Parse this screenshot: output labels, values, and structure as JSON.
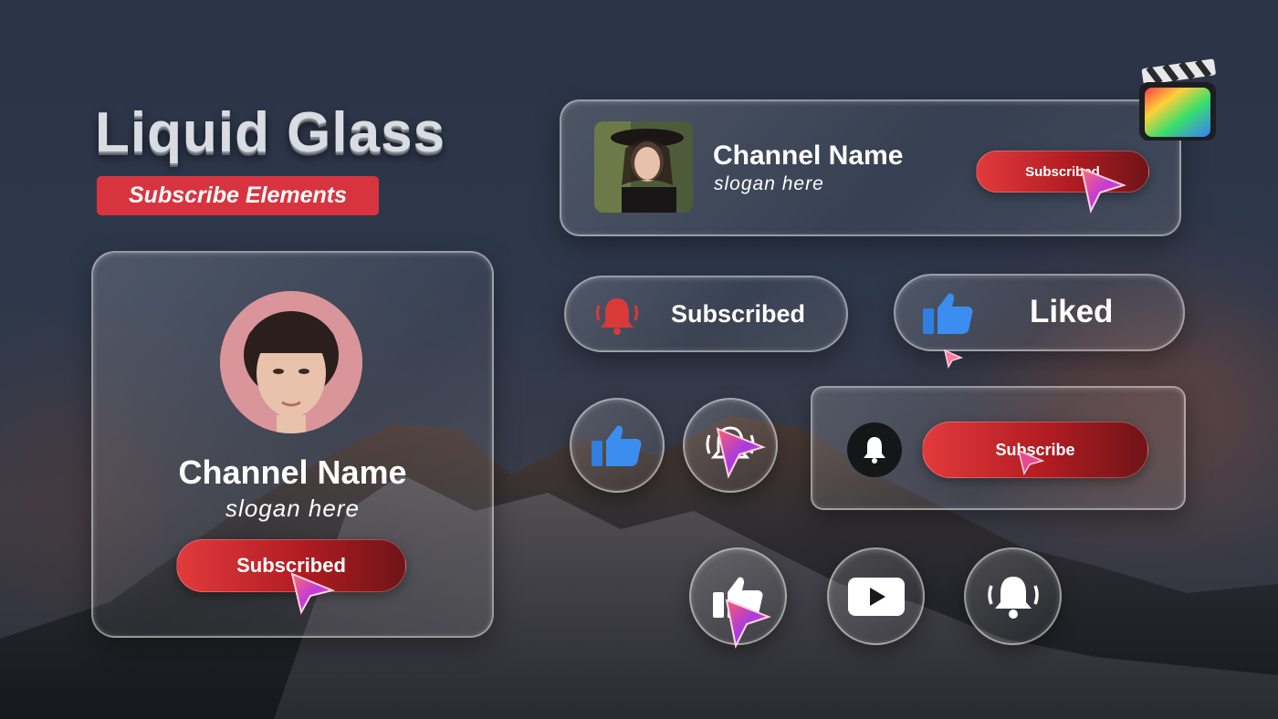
{
  "title": "Liquid Glass",
  "subtitle": "Subscribe Elements",
  "big_card": {
    "channel_name": "Channel Name",
    "slogan": "slogan here",
    "button_label": "Subscribed"
  },
  "top_card": {
    "channel_name": "Channel Name",
    "slogan": "slogan here",
    "button_label": "Subscribed"
  },
  "pill_subscribed": {
    "label": "Subscribed"
  },
  "pill_liked": {
    "label": "Liked"
  },
  "subscribe_card": {
    "button_label": "Subscribe"
  },
  "icons": {
    "bell": "bell-icon",
    "like": "thumbs-up-icon",
    "ringing_bell": "ringing-bell-icon",
    "play": "play-icon",
    "cursor": "cursor-icon",
    "app_logo": "clapperboard-app-icon"
  },
  "colors": {
    "accent_red": "#d8343f",
    "like_blue": "#2f7fe0",
    "bell_red": "#d83a3a"
  }
}
